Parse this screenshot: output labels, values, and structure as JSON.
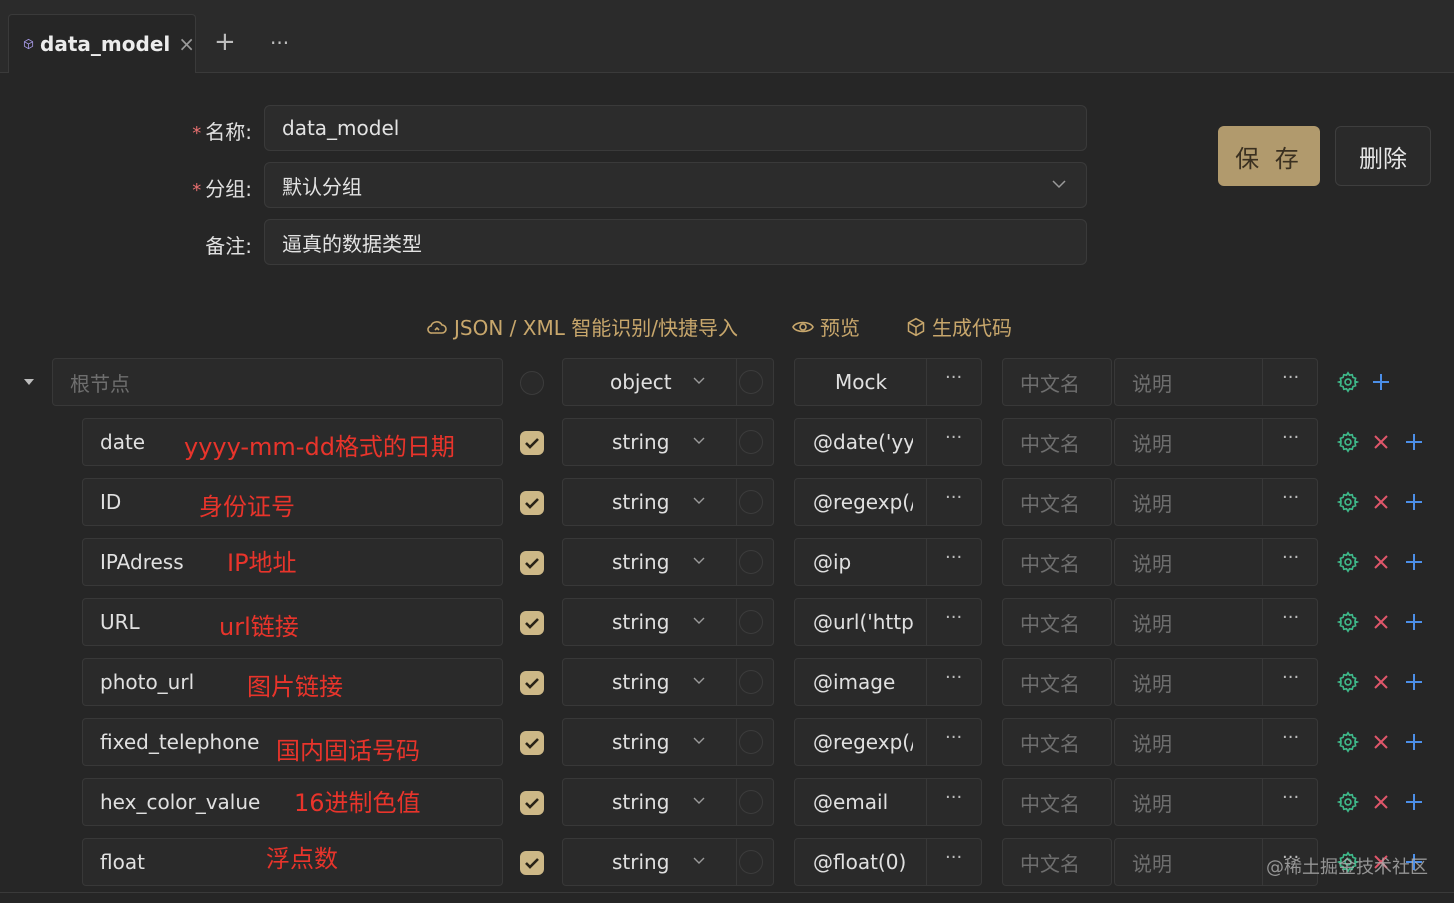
{
  "tab": {
    "title": "data_model",
    "close": "×",
    "add": "+",
    "more": "···"
  },
  "form": {
    "req_mark": "*",
    "name_label": "名称:",
    "name_value": "data_model",
    "group_label": "分组:",
    "group_value": "默认分组",
    "remark_label": "备注:",
    "remark_value": "逼真的数据类型"
  },
  "buttons": {
    "save": "保 存",
    "delete": "删除"
  },
  "toolbar": {
    "import": "JSON / XML 智能识别/快捷导入",
    "preview": "预览",
    "generate": "生成代码"
  },
  "root": {
    "placeholder": "根节点",
    "type": "object",
    "mock_placeholder": "Mock",
    "cn_placeholder": "中文名",
    "desc_placeholder": "说明",
    "dots": "···"
  },
  "rows": [
    {
      "name": "date",
      "annotation": "yyyy-mm-dd格式的日期",
      "type": "string",
      "mock": "@date('yyy",
      "cn_placeholder": "中文名",
      "desc_placeholder": "说明",
      "dots": "···"
    },
    {
      "name": "ID",
      "annotation": "身份证号",
      "type": "string",
      "mock": "@regexp(/",
      "cn_placeholder": "中文名",
      "desc_placeholder": "说明",
      "dots": "···"
    },
    {
      "name": "IPAdress",
      "annotation": "IP地址",
      "type": "string",
      "mock": "@ip",
      "cn_placeholder": "中文名",
      "desc_placeholder": "说明",
      "dots": "···"
    },
    {
      "name": "URL",
      "annotation": "url链接",
      "type": "string",
      "mock": "@url('http'",
      "cn_placeholder": "中文名",
      "desc_placeholder": "说明",
      "dots": "···"
    },
    {
      "name": "photo_url",
      "annotation": "图片链接",
      "type": "string",
      "mock": "@image",
      "cn_placeholder": "中文名",
      "desc_placeholder": "说明",
      "dots": "···"
    },
    {
      "name": "fixed_telephone",
      "annotation": "国内固话号码",
      "type": "string",
      "mock": "@regexp(/",
      "cn_placeholder": "中文名",
      "desc_placeholder": "说明",
      "dots": "···"
    },
    {
      "name": "hex_color_value",
      "annotation": "16进制色值",
      "type": "string",
      "mock": "@email",
      "cn_placeholder": "中文名",
      "desc_placeholder": "说明",
      "dots": "···"
    },
    {
      "name": "float",
      "annotation": "浮点数",
      "type": "string",
      "mock": "@float(0)",
      "cn_placeholder": "中文名",
      "desc_placeholder": "说明",
      "dots": "···"
    }
  ],
  "watermark": "@稀土掘金技术社区",
  "colors": {
    "accent": "#c8a76c",
    "save_bg": "#b19a6d",
    "gear": "#3fb98a",
    "delete": "#e0566a",
    "add": "#4c8fe8",
    "annotation": "#e8342b"
  }
}
